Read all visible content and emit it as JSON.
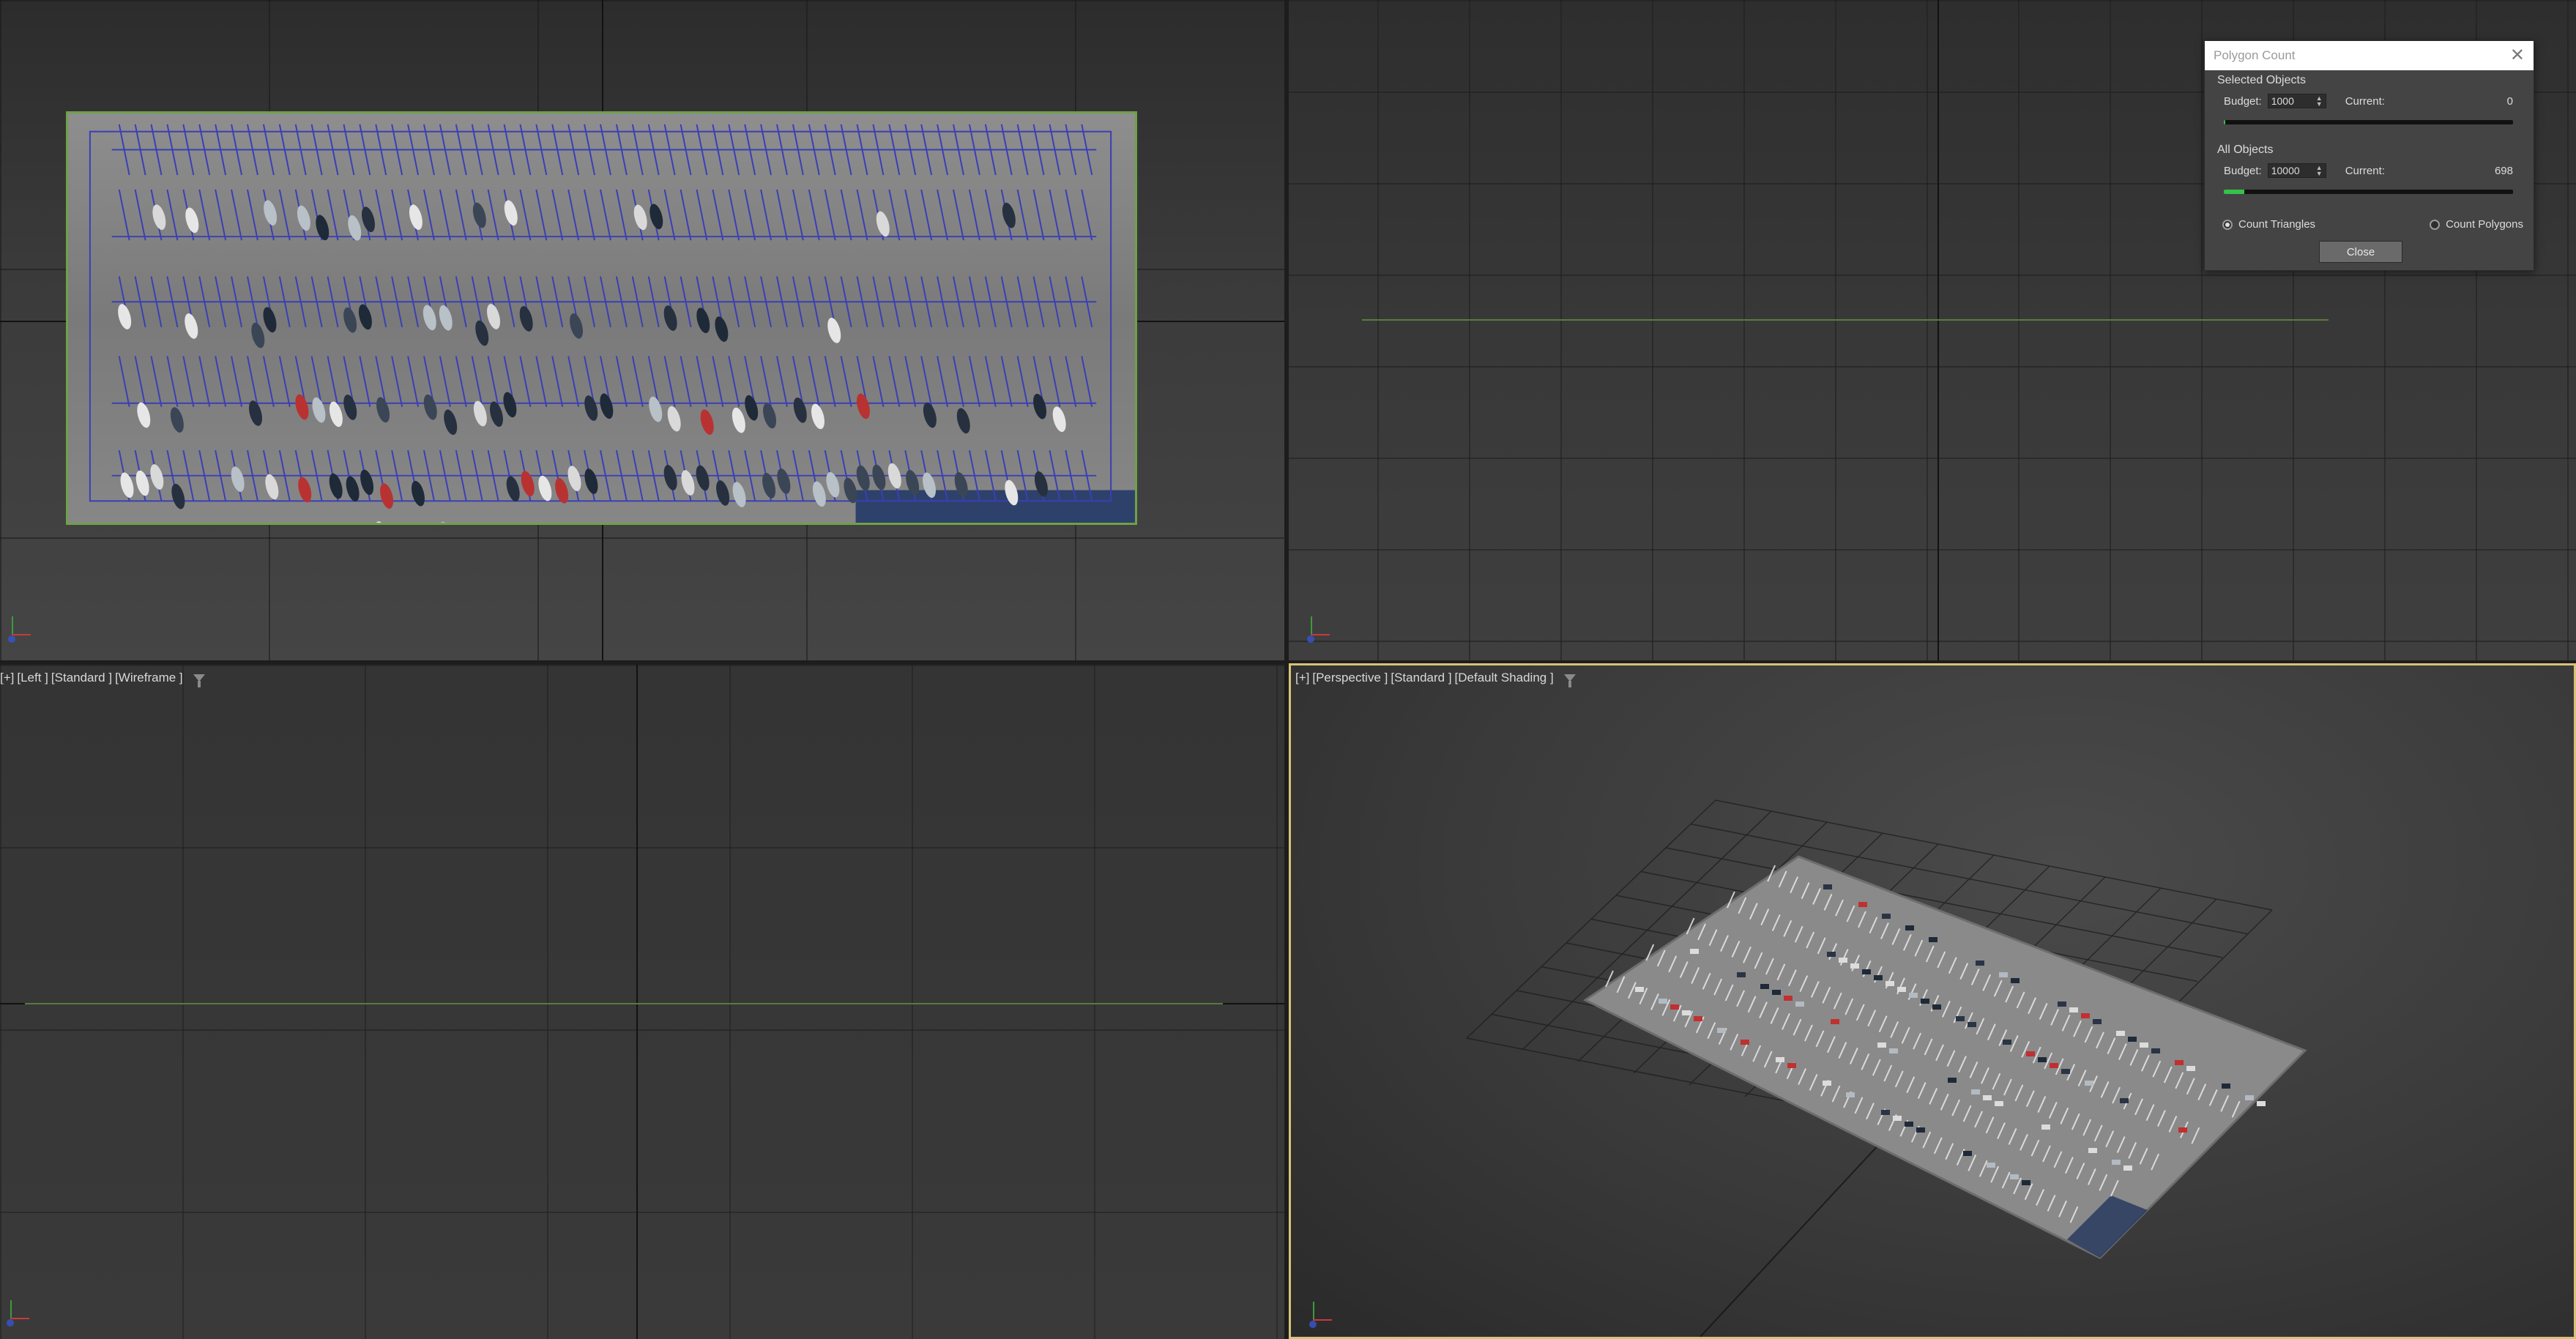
{
  "viewports": {
    "left": {
      "plus": "[+]",
      "view": "[Left ]",
      "shading_std": "[Standard ]",
      "shading": "[Wireframe ]"
    },
    "perspective": {
      "plus": "[+]",
      "view": "[Perspective ]",
      "shading_std": "[Standard ]",
      "shading": "[Default Shading ]"
    }
  },
  "polygon_dialog": {
    "title": "Polygon Count",
    "selected_objects": {
      "heading": "Selected Objects",
      "budget_label": "Budget:",
      "budget_value": "1000",
      "current_label": "Current:",
      "current_value": "0",
      "usage_fraction": 0.0
    },
    "all_objects": {
      "heading": "All Objects",
      "budget_label": "Budget:",
      "budget_value": "10000",
      "current_label": "Current:",
      "current_value": "698",
      "usage_fraction": 0.0698
    },
    "count_triangles_label": "Count Triangles",
    "count_polygons_label": "Count Polygons",
    "count_mode_selected": "triangles",
    "close_button_label": "Close"
  },
  "colors": {
    "active_viewport_border": "#d8c27a",
    "bar_fill": "#34c24a",
    "selection_border": "#6ea148"
  },
  "icons": {
    "filter": "funnel-icon",
    "close": "close-icon",
    "axis": "axis-gizmo-icon"
  }
}
